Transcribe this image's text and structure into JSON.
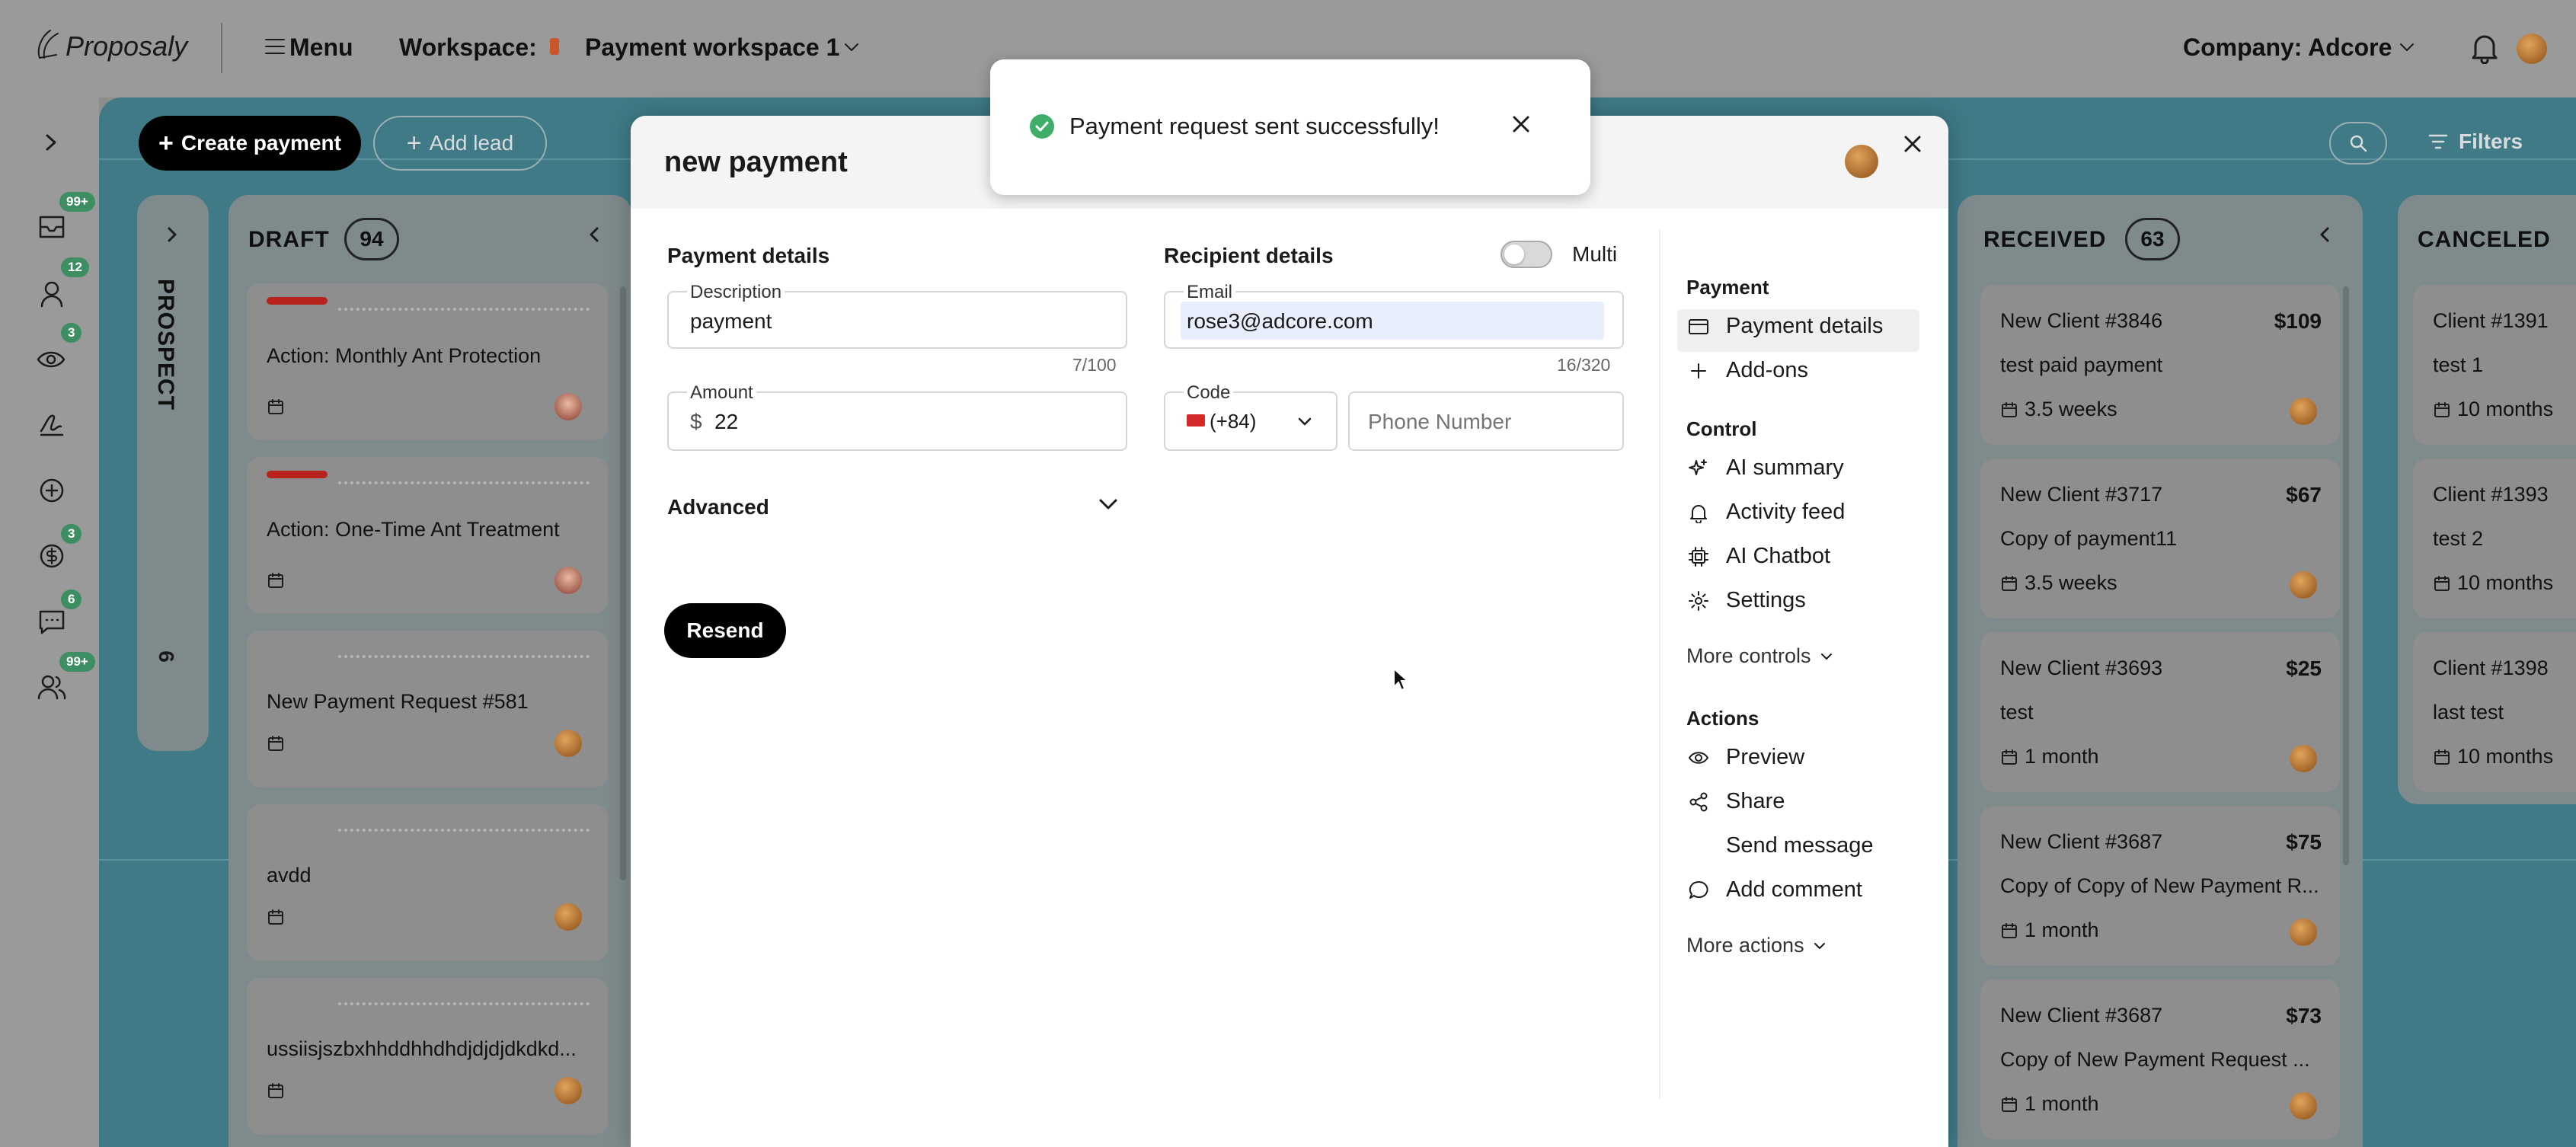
{
  "topbar": {
    "logo_text": "Proposaly",
    "menu_label": "Menu",
    "workspace_label": "Workspace:",
    "workspace_name": "Payment workspace 1",
    "company_label": "Company: Adcore"
  },
  "rail": {
    "badges": [
      "99+",
      "12",
      "3",
      "3",
      "6",
      "99+"
    ]
  },
  "board": {
    "create_payment_label": "Create payment",
    "add_lead_label": "Add lead",
    "filters_label": "Filters",
    "prospect_label": "PROSPECT",
    "prospect_count": "6",
    "draft": {
      "title": "DRAFT",
      "count": "94",
      "cards": [
        {
          "title": "Action: Monthly Ant Protection"
        },
        {
          "title": "Action: One-Time Ant Treatment"
        },
        {
          "title": "New Payment Request #581"
        },
        {
          "title": "avdd"
        },
        {
          "title": "ussiisjszbxhhddhhdhdjdjdjdkdkd..."
        }
      ]
    },
    "received": {
      "title": "RECEIVED",
      "count": "63",
      "cards": [
        {
          "title": "New Client #3846",
          "amount": "$109",
          "subtitle": "test paid payment",
          "time": "3.5 weeks"
        },
        {
          "title": "New Client #3717",
          "amount": "$67",
          "subtitle": "Copy of payment11",
          "time": "3.5 weeks"
        },
        {
          "title": "New Client #3693",
          "amount": "$25",
          "subtitle": "test",
          "time": "1 month"
        },
        {
          "title": "New Client #3687",
          "amount": "$75",
          "subtitle": "Copy of Copy of New Payment R...",
          "time": "1 month"
        },
        {
          "title": "New Client #3687",
          "amount": "$73",
          "subtitle": "Copy of New Payment Request ...",
          "time": "1 month"
        }
      ]
    },
    "canceled": {
      "title": "CANCELED",
      "cards": [
        {
          "title": "Client #1391",
          "subtitle": "test 1",
          "time": "10 months"
        },
        {
          "title": "Client #1393",
          "subtitle": "test 2",
          "time": "10 months"
        },
        {
          "title": "Client #1398",
          "subtitle": "last test",
          "time": "10 months"
        }
      ]
    }
  },
  "modal": {
    "title": "new payment",
    "payment_details_title": "Payment details",
    "description_label": "Description",
    "description_value": "payment",
    "description_counter": "7/100",
    "amount_label": "Amount",
    "currency_symbol": "$",
    "amount_value": "22",
    "advanced_label": "Advanced",
    "resend_label": "Resend",
    "recipient_title": "Recipient details",
    "multi_label": "Multi",
    "email_label": "Email",
    "email_value": "rose3@adcore.com",
    "email_counter": "16/320",
    "code_label": "Code",
    "code_value": "(+84)",
    "phone_placeholder": "Phone Number",
    "side": {
      "payment_head": "Payment",
      "payment_details": "Payment details",
      "addons": "Add-ons",
      "control_head": "Control",
      "ai_summary": "AI summary",
      "activity_feed": "Activity feed",
      "ai_chatbot": "AI Chatbot",
      "settings": "Settings",
      "more_controls": "More controls",
      "actions_head": "Actions",
      "preview": "Preview",
      "share": "Share",
      "send_message": "Send message",
      "add_comment": "Add comment",
      "more_actions": "More actions"
    }
  },
  "toast": {
    "message": "Payment request sent successfully!",
    "success_color": "#3fae6a"
  }
}
